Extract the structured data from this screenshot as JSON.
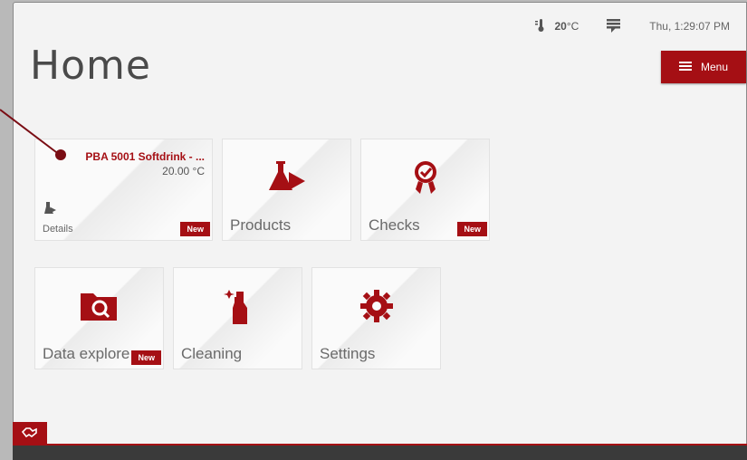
{
  "header": {
    "temperature": "20",
    "temperature_unit": "°C",
    "datetime": "Thu, 1:29:07 PM",
    "title": "Home",
    "menu_label": "Menu"
  },
  "tiles": {
    "product": {
      "name": "PBA 5001 Softdrink - ...",
      "temperature": "20.00 °C",
      "details_label": "Details",
      "badge": "New"
    },
    "products": {
      "label": "Products",
      "icon": "flask-icon"
    },
    "checks": {
      "label": "Checks",
      "icon": "award-check-icon",
      "badge": "New"
    },
    "data_explorer": {
      "label": "Data explore",
      "icon": "folder-search-icon",
      "badge": "New"
    },
    "cleaning": {
      "label": "Cleaning",
      "icon": "spray-bottle-icon"
    },
    "settings": {
      "label": "Settings",
      "icon": "gear-wrench-icon"
    }
  },
  "colors": {
    "accent": "#a50f14",
    "background": "#f3f3f3"
  }
}
